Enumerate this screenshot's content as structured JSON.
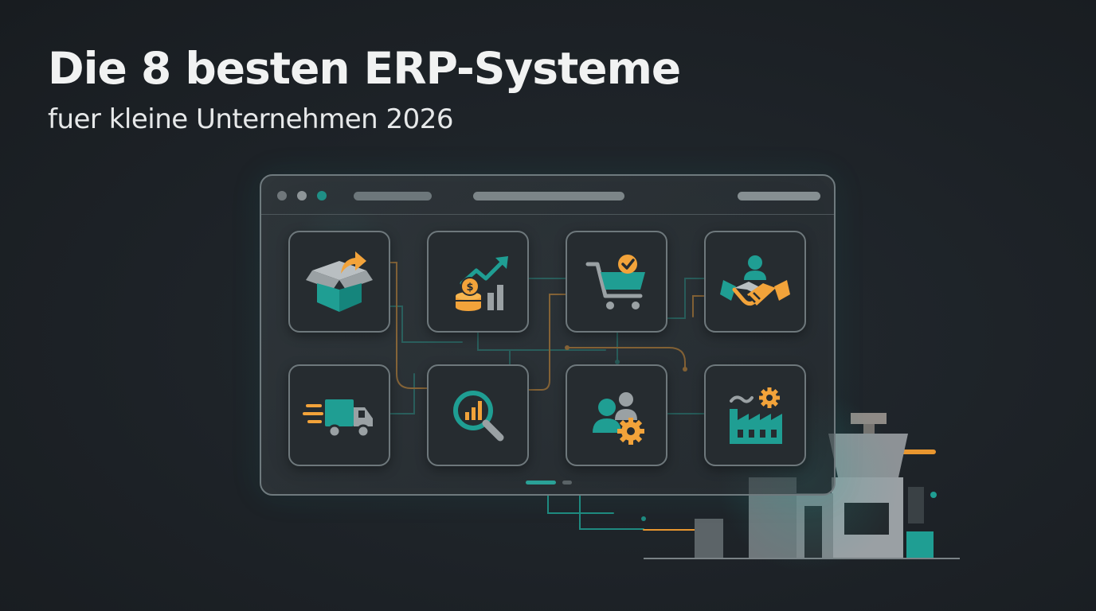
{
  "header": {
    "title": "Die 8 besten ERP-Systeme",
    "subtitle": "fuer kleine Unternehmen 2026"
  },
  "colors": {
    "background": "#1d2227",
    "teal": "#1f9e93",
    "orange": "#f2a33a",
    "gray": "#9aa1a4",
    "tile_border": "#6e787c"
  },
  "modules": [
    {
      "icon": "box-shipping-icon"
    },
    {
      "icon": "finance-growth-icon"
    },
    {
      "icon": "shopping-cart-icon"
    },
    {
      "icon": "handshake-icon"
    },
    {
      "icon": "delivery-truck-icon"
    },
    {
      "icon": "analytics-search-icon"
    },
    {
      "icon": "team-settings-icon"
    },
    {
      "icon": "factory-icon"
    }
  ]
}
